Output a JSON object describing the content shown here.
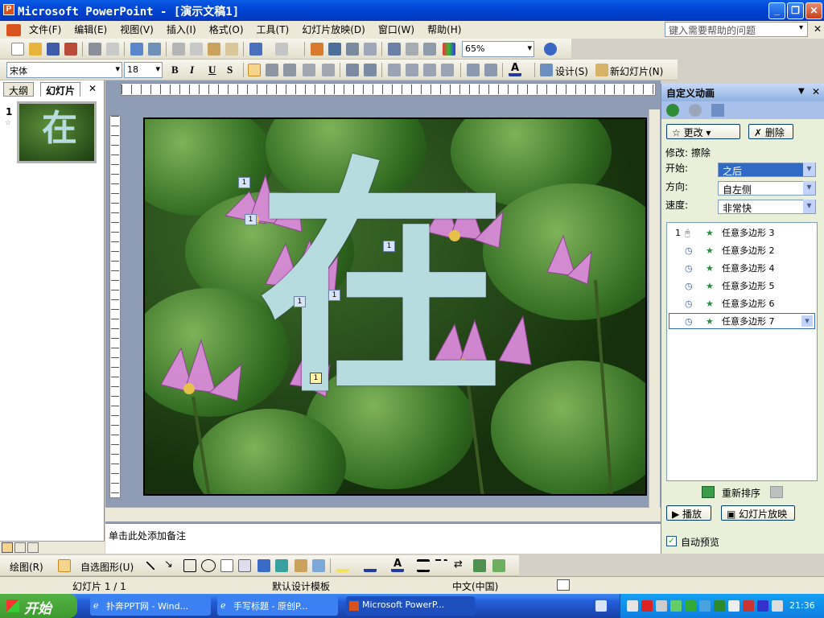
{
  "window": {
    "title": "Microsoft PowerPoint - [演示文稿1]",
    "app_icon": "P"
  },
  "menu": [
    "文件(F)",
    "编辑(E)",
    "视图(V)",
    "插入(I)",
    "格式(O)",
    "工具(T)",
    "幻灯片放映(D)",
    "窗口(W)",
    "帮助(H)"
  ],
  "help_placeholder": "键入需要帮助的问题",
  "toolbar": {
    "zoom": "65%",
    "font": "宋体",
    "size": "18",
    "design": "设计(S)",
    "new_slide": "新幻灯片(N)",
    "bold": "B",
    "italic": "I",
    "underline": "U",
    "shadow": "S"
  },
  "left_tabs": [
    "大纲",
    "幻灯片"
  ],
  "thumb": {
    "number": "1"
  },
  "slide": {
    "character": "在",
    "tags": [
      "1",
      "1",
      "1",
      "1",
      "1",
      "1"
    ]
  },
  "notes_placeholder": "单击此处添加备注",
  "taskpane": {
    "title": "自定义动画",
    "change_btn": "更改",
    "delete_btn": "删除",
    "modify": "修改: 擦除",
    "start_label": "开始:",
    "start_value": "之后",
    "direction_label": "方向:",
    "direction_value": "自左侧",
    "speed_label": "速度:",
    "speed_value": "非常快",
    "items": [
      {
        "num": "1",
        "name": "任意多边形 3"
      },
      {
        "num": "",
        "name": "任意多边形 2"
      },
      {
        "num": "",
        "name": "任意多边形 4"
      },
      {
        "num": "",
        "name": "任意多边形 5"
      },
      {
        "num": "",
        "name": "任意多边形 6"
      },
      {
        "num": "",
        "name": "任意多边形 7"
      }
    ],
    "reorder": "重新排序",
    "play": "播放",
    "slideshow": "幻灯片放映",
    "autopreview": "自动预览"
  },
  "drawbar": {
    "draw": "绘图(R)",
    "autoshapes": "自选图形(U)"
  },
  "status": {
    "slide": "幻灯片 1 / 1",
    "template": "默认设计模板",
    "lang": "中文(中国)"
  },
  "taskbar": {
    "start": "开始",
    "tasks": [
      "扑奔PPT网 - Wind...",
      "手写标题 - 原创P...",
      "Microsoft PowerP..."
    ],
    "time": "21:36"
  },
  "colors": {
    "titlebar": "#0046d5",
    "glyph": "#b7dce0",
    "taskpane_head": "#8db2e3"
  }
}
